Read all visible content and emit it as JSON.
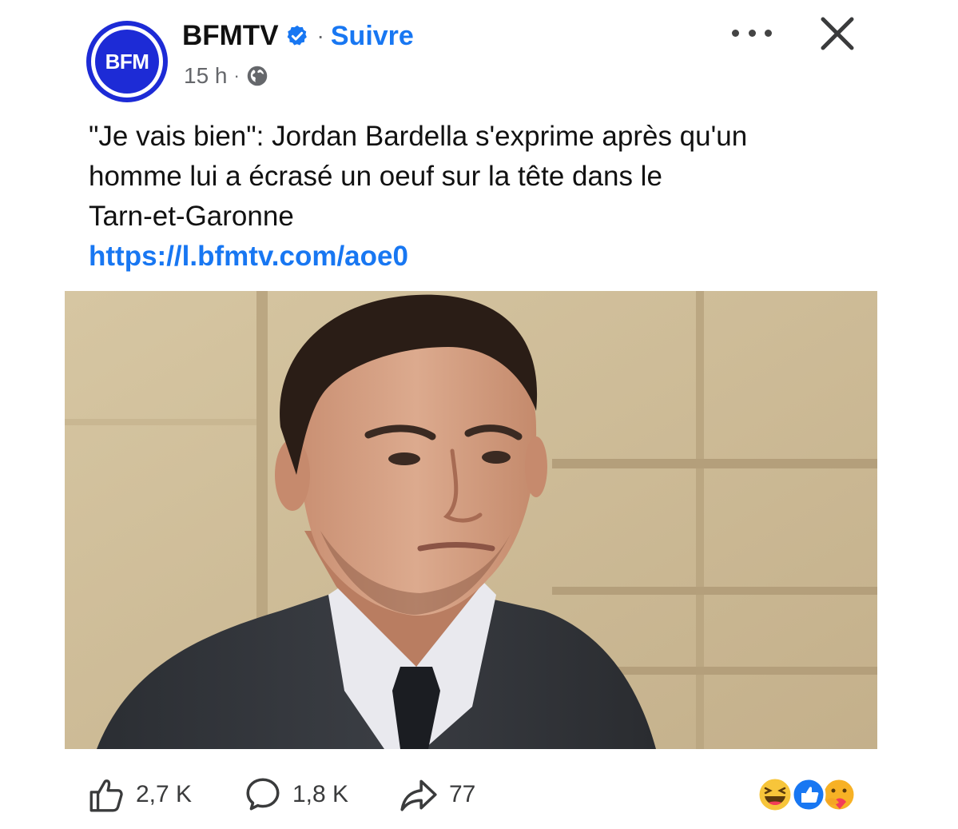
{
  "post": {
    "page_name": "BFMTV",
    "avatar_text": "BFM",
    "follow_label": "Suivre",
    "separator": "·",
    "timestamp": "15 h",
    "text_lines": [
      "\"Je vais bien\": Jordan Bardella s'exprime après qu'un",
      "homme lui a écrasé un oeuf sur la tête dans le",
      "Tarn-et-Garonne"
    ],
    "link": "https://l.bfmtv.com/aoe0"
  },
  "icons": {
    "verified": "verified-badge-icon",
    "audience": "globe-icon",
    "more": "more-options-icon",
    "close": "close-icon",
    "like": "thumbs-up-icon",
    "comment": "comment-icon",
    "share": "share-arrow-icon",
    "reactions": [
      "haha-reaction-icon",
      "like-reaction-icon",
      "care-reaction-icon"
    ]
  },
  "footer": {
    "likes": "2,7 K",
    "comments": "1,8 K",
    "shares": "77"
  },
  "colors": {
    "brand_blue": "#1d2bd6",
    "link_blue": "#1877f2",
    "muted_text": "#65676b"
  }
}
